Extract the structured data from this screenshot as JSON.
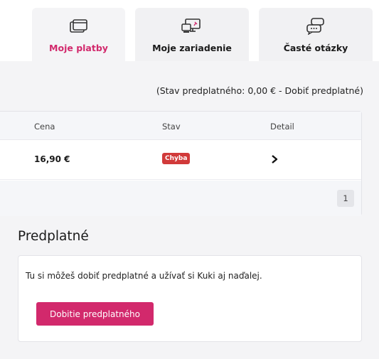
{
  "tabs": [
    {
      "label": "Moje platby",
      "icon": "cards-icon",
      "active": true
    },
    {
      "label": "Moje zariadenie",
      "icon": "devices-icon",
      "active": false
    },
    {
      "label": "Časté otázky",
      "icon": "chat-bubbles-icon",
      "active": false
    }
  ],
  "balance": {
    "text": "(Stav predplatného: 0,00 € - ",
    "link": "Dobiť predplatné",
    "close": ")"
  },
  "table": {
    "headers": [
      "Cena",
      "Stav",
      "Detail"
    ],
    "rows": [
      {
        "price": "16,90 €",
        "status": "Chyba"
      }
    ],
    "page": "1"
  },
  "subscription": {
    "title": "Predplatné",
    "text": "Tu si môžeš dobiť predplatné a užívať si Kuki aj naďalej.",
    "button": "Dobitie predplatného"
  },
  "colors": {
    "accent": "#d2296c",
    "error_badge": "#d13a3a",
    "panel_bg": "#f4f4f6"
  }
}
